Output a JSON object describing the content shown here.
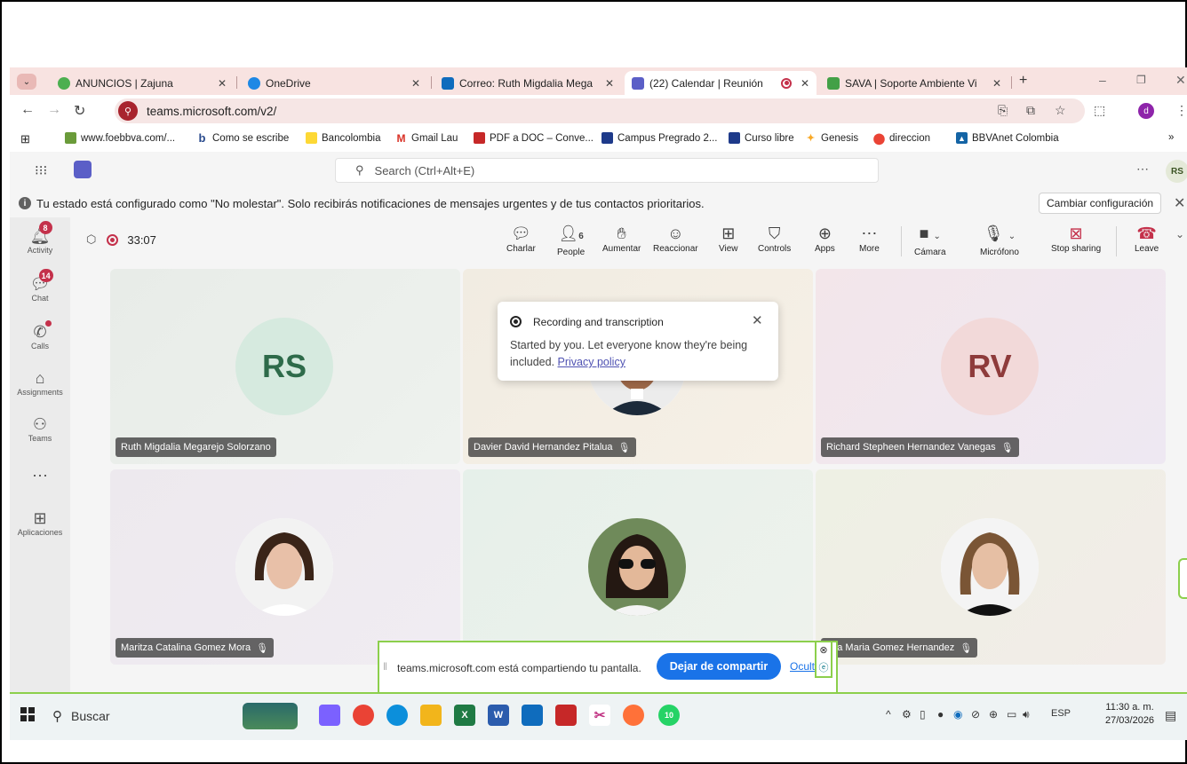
{
  "browser": {
    "tabs": [
      {
        "title": "ANUNCIOS | Zajuna",
        "color": "#4caf50"
      },
      {
        "title": "OneDrive",
        "color": "#1e88e5"
      },
      {
        "title": "Correo: Ruth Migdalia Mega",
        "color": "#0f6cbd"
      },
      {
        "title": "(22) Calendar | Reunión",
        "color": "#5b5fc7"
      },
      {
        "title": "SAVA | Soporte Ambiente Vi",
        "color": "#43a047"
      }
    ],
    "url": "teams.microsoft.com/v2/",
    "profile_initial": "d",
    "bookmarks": [
      "www.foebbva.com/...",
      "Como se escribe",
      "Bancolombia",
      "Gmail Lau",
      "PDF a DOC – Conve...",
      "Campus Pregrado 2...",
      "Curso libre",
      "Genesis",
      "direccion",
      "BBVAnet Colombia"
    ]
  },
  "teams": {
    "search_placeholder": "Search (Ctrl+Alt+E)",
    "user_initials": "RS",
    "banner_text": "Tu estado está configurado como \"No molestar\". Solo recibirás notificaciones de mensajes urgentes y de tus contactos prioritarios.",
    "banner_button": "Cambiar configuración",
    "rail": [
      {
        "label": "Activity",
        "badge": "8"
      },
      {
        "label": "Chat",
        "badge": "14"
      },
      {
        "label": "Calls"
      },
      {
        "label": "Assignments"
      },
      {
        "label": "Teams"
      },
      {
        "label": "Aplicaciones"
      }
    ],
    "meeting": {
      "timer": "33:07",
      "people_count": "6",
      "controls": [
        "Charlar",
        "People",
        "Aumentar",
        "Reaccionar",
        "View",
        "Controls",
        "Apps",
        "More",
        "Cámara",
        "Micrófono",
        "Stop sharing",
        "Leave"
      ],
      "participants": [
        {
          "name": "Ruth Migdalia Megarejo Solorzano",
          "initials": "RS",
          "bg": "#d6eadf",
          "fg": "#2e6b4a"
        },
        {
          "name": "Davier David Hernandez Pitalua",
          "initials": ""
        },
        {
          "name": "Richard Stepheen Hernandez Vanegas",
          "initials": "RV",
          "bg": "#f2d9d9",
          "fg": "#8e3b3b"
        },
        {
          "name": "Maritza Catalina Gomez Mora",
          "initials": ""
        },
        {
          "name": "",
          "initials": ""
        },
        {
          "name": "ana Maria Gomez Hernandez",
          "initials": ""
        }
      ],
      "popup": {
        "title": "Recording and transcription",
        "body": "Started by you. Let everyone know they're being included.",
        "link": "Privacy policy"
      }
    }
  },
  "screen_share": {
    "text": "teams.microsoft.com está compartiendo tu pantalla.",
    "stop_label": "Dejar de compartir",
    "hide_label": "Ocult"
  },
  "taskbar": {
    "search_label": "Buscar",
    "lang": "ESP",
    "time": "11:30 a. m.",
    "date": "27/03/2026",
    "whatsapp_badge": "10"
  }
}
